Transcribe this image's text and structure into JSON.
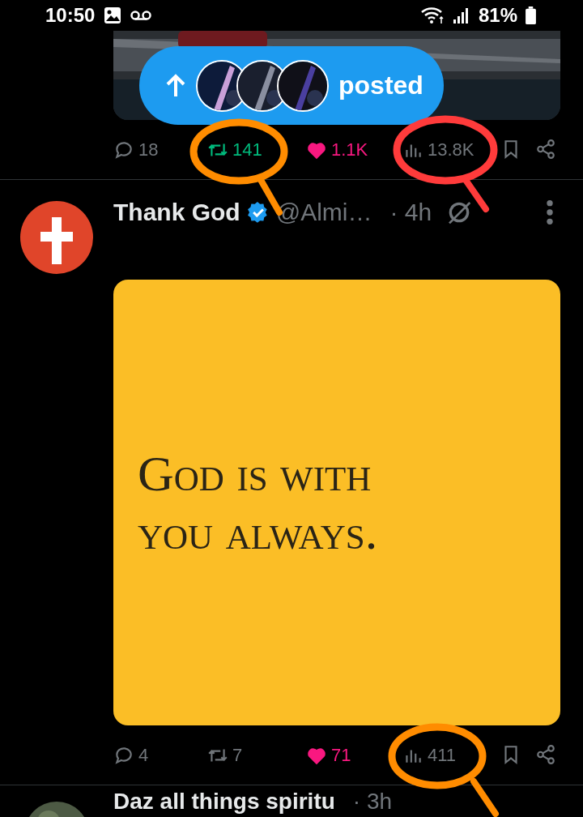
{
  "status_bar": {
    "time": "10:50",
    "battery": "81%"
  },
  "new_posts_pill": {
    "label": "posted"
  },
  "posts": [
    {
      "actions": {
        "replies": "18",
        "reposts": "141",
        "reposted": true,
        "likes": "1.1K",
        "liked": true,
        "views": "13.8K"
      }
    },
    {
      "author": "Thank God",
      "verified": true,
      "handle": "@Almi…",
      "time": "· 4h",
      "media_text": "God is with you always.",
      "actions": {
        "replies": "4",
        "reposts": "7",
        "reposted": false,
        "likes": "71",
        "liked": true,
        "views": "411"
      }
    },
    {
      "author": "Daz all things spiritu",
      "time": "· 3h"
    }
  ],
  "annotations": [
    {
      "color": "#ff8c00"
    },
    {
      "color": "#ff3b3b"
    },
    {
      "color": "#ff8c00"
    }
  ]
}
